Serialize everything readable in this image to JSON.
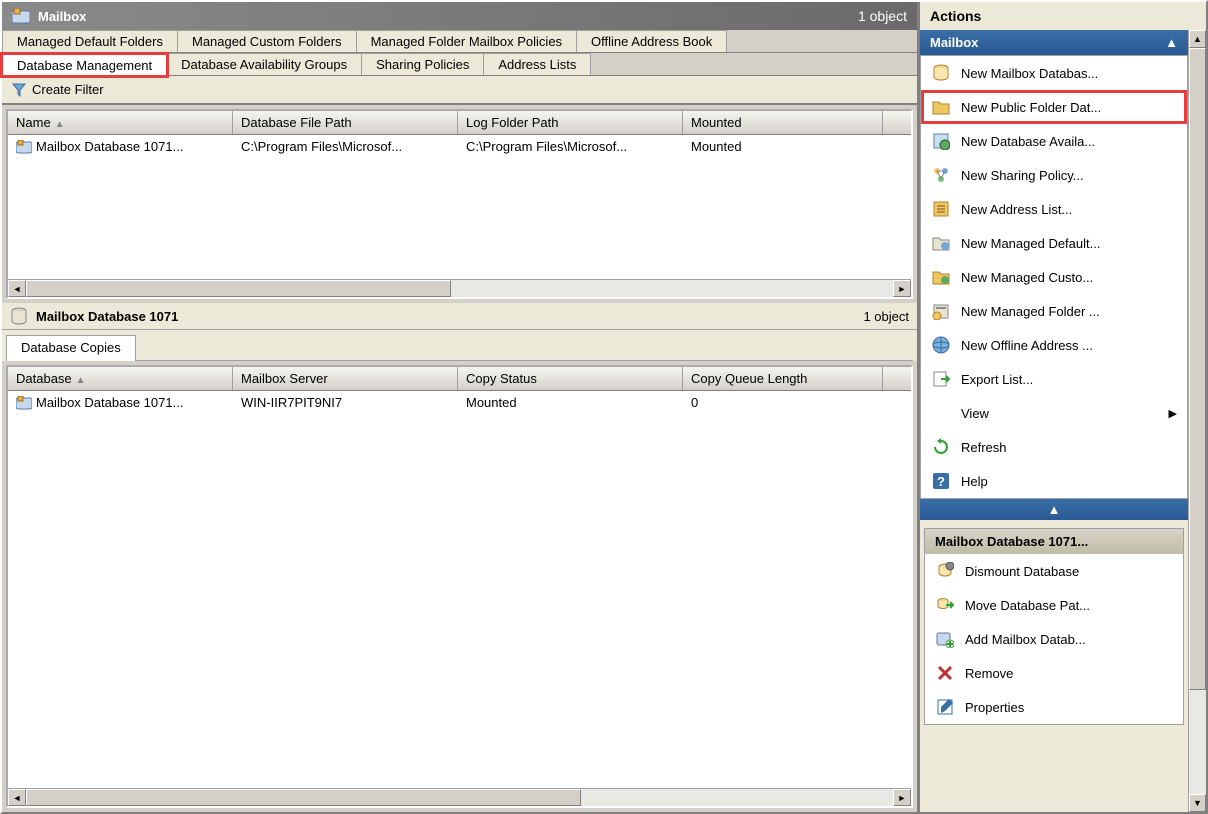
{
  "mailboxPane": {
    "title": "Mailbox",
    "objectCount": "1 object"
  },
  "tabsRow1": [
    {
      "label": "Managed Default Folders",
      "active": false,
      "highlight": false
    },
    {
      "label": "Managed Custom Folders",
      "active": false,
      "highlight": false
    },
    {
      "label": "Managed Folder Mailbox Policies",
      "active": false,
      "highlight": false
    },
    {
      "label": "Offline Address Book",
      "active": false,
      "highlight": false
    }
  ],
  "tabsRow2": [
    {
      "label": "Database Management",
      "active": true,
      "highlight": true
    },
    {
      "label": "Database Availability Groups",
      "active": false,
      "highlight": false
    },
    {
      "label": "Sharing Policies",
      "active": false,
      "highlight": false
    },
    {
      "label": "Address Lists",
      "active": false,
      "highlight": false
    }
  ],
  "toolbar": {
    "createFilter": "Create Filter"
  },
  "topGrid": {
    "columns": [
      "Name",
      "Database File Path",
      "Log Folder Path",
      "Mounted"
    ],
    "widths": [
      225,
      225,
      225,
      200
    ],
    "sortCol": 0,
    "rows": [
      {
        "name": "Mailbox Database 1071...",
        "filePath": "C:\\Program Files\\Microsof...",
        "logPath": "C:\\Program Files\\Microsof...",
        "mounted": "Mounted"
      }
    ]
  },
  "detailPane": {
    "title": "Mailbox Database 1071",
    "objectCount": "1 object",
    "copiesTab": "Database Copies"
  },
  "bottomGrid": {
    "columns": [
      "Database",
      "Mailbox Server",
      "Copy Status",
      "Copy Queue Length"
    ],
    "widths": [
      225,
      225,
      225,
      200
    ],
    "sortCol": 0,
    "rows": [
      {
        "database": "Mailbox Database 1071...",
        "server": "WIN-IIR7PIT9NI7",
        "status": "Mounted",
        "queue": "0"
      }
    ]
  },
  "actionsPane": {
    "title": "Actions",
    "section1": {
      "header": "Mailbox",
      "items": [
        {
          "label": "New Mailbox Databas...",
          "icon": "db-icon",
          "highlight": false
        },
        {
          "label": "New Public Folder Dat...",
          "icon": "folder-icon",
          "highlight": true
        },
        {
          "label": "New Database Availa...",
          "icon": "dbavail-icon",
          "highlight": false
        },
        {
          "label": "New Sharing Policy...",
          "icon": "sharing-icon",
          "highlight": false
        },
        {
          "label": "New Address List...",
          "icon": "addrlist-icon",
          "highlight": false
        },
        {
          "label": "New Managed Default...",
          "icon": "mgdef-icon",
          "highlight": false
        },
        {
          "label": "New Managed Custo...",
          "icon": "mgcust-icon",
          "highlight": false
        },
        {
          "label": "New Managed Folder ...",
          "icon": "mgfolder-icon",
          "highlight": false
        },
        {
          "label": "New Offline Address ...",
          "icon": "offaddr-icon",
          "highlight": false
        },
        {
          "label": "Export List...",
          "icon": "export-icon",
          "highlight": false
        },
        {
          "label": "View",
          "icon": "",
          "submenu": true,
          "highlight": false
        },
        {
          "label": "Refresh",
          "icon": "refresh-icon",
          "highlight": false
        },
        {
          "label": "Help",
          "icon": "help-icon",
          "highlight": false
        }
      ]
    },
    "section2": {
      "header": "Mailbox Database 1071...",
      "items": [
        {
          "label": "Dismount Database",
          "icon": "dismount-icon"
        },
        {
          "label": "Move Database Pat...",
          "icon": "move-icon"
        },
        {
          "label": "Add Mailbox Datab...",
          "icon": "adddb-icon"
        },
        {
          "label": "Remove",
          "icon": "remove-icon"
        },
        {
          "label": "Properties",
          "icon": "props-icon"
        }
      ]
    }
  }
}
